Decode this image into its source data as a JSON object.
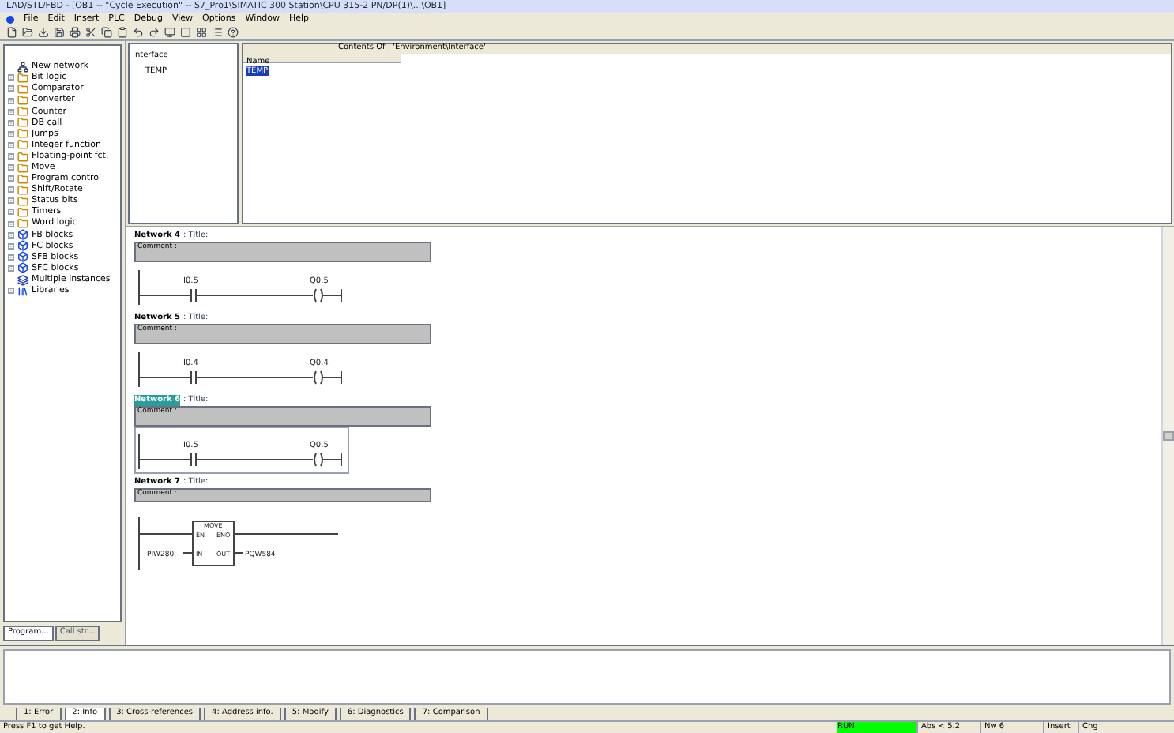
{
  "window": {
    "title": "LAD/STL/FBD - [OB1 -- \"Cycle Execution\" -- S7_Pro1\\SIMATIC 300 Station\\CPU 315-2 PN/DP(1)\\...\\OB1]"
  },
  "menu": [
    "File",
    "Edit",
    "Insert",
    "PLC",
    "Debug",
    "View",
    "Options",
    "Window",
    "Help"
  ],
  "sidebar": {
    "items": [
      {
        "label": "New network",
        "kind": "network",
        "expandable": false
      },
      {
        "label": "Bit logic",
        "kind": "folder",
        "expandable": true
      },
      {
        "label": "Comparator",
        "kind": "folder",
        "expandable": true
      },
      {
        "label": "Converter",
        "kind": "folder",
        "expandable": true
      },
      {
        "label": "Counter",
        "kind": "folder",
        "expandable": true
      },
      {
        "label": "DB call",
        "kind": "folder",
        "expandable": true
      },
      {
        "label": "Jumps",
        "kind": "folder",
        "expandable": true
      },
      {
        "label": "Integer function",
        "kind": "folder",
        "expandable": true
      },
      {
        "label": "Floating-point fct.",
        "kind": "folder",
        "expandable": true
      },
      {
        "label": "Move",
        "kind": "folder",
        "expandable": true
      },
      {
        "label": "Program control",
        "kind": "folder",
        "expandable": true
      },
      {
        "label": "Shift/Rotate",
        "kind": "folder",
        "expandable": true
      },
      {
        "label": "Status bits",
        "kind": "folder",
        "expandable": true
      },
      {
        "label": "Timers",
        "kind": "folder",
        "expandable": true
      },
      {
        "label": "Word logic",
        "kind": "folder",
        "expandable": true
      },
      {
        "label": "FB blocks",
        "kind": "block",
        "expandable": true
      },
      {
        "label": "FC blocks",
        "kind": "block",
        "expandable": true
      },
      {
        "label": "SFB blocks",
        "kind": "block",
        "expandable": true
      },
      {
        "label": "SFC blocks",
        "kind": "block",
        "expandable": true
      },
      {
        "label": "Multiple instances",
        "kind": "instances",
        "expandable": false
      },
      {
        "label": "Libraries",
        "kind": "libraries",
        "expandable": true
      }
    ],
    "tabs": [
      {
        "label": "Program...",
        "selected": true
      },
      {
        "label": "Call str...",
        "selected": false
      }
    ]
  },
  "interface": {
    "tree": [
      {
        "label": "Interface",
        "children": [
          {
            "label": "TEMP"
          }
        ]
      }
    ],
    "header": "Contents Of : 'Environment\\Interface'",
    "column": "Name",
    "rows": [
      "TEMP"
    ]
  },
  "networks": [
    {
      "number": "Network 4",
      "title": ": Title:",
      "comment": "Comment :",
      "selected": false,
      "kind": "contact",
      "input": "I0.5",
      "output": "Q0.5"
    },
    {
      "number": "Network 5",
      "title": ": Title:",
      "comment": "Comment :",
      "selected": false,
      "kind": "contact",
      "input": "I0.4",
      "output": "Q0.4"
    },
    {
      "number": "Network 6",
      "title": ": Title:",
      "comment": "Comment :",
      "selected": true,
      "kind": "contact",
      "input": "I0.5",
      "output": "Q0.5"
    },
    {
      "number": "Network 7",
      "title": ": Title:",
      "comment": "Comment :",
      "selected": false,
      "kind": "move",
      "box": "MOVE",
      "pins": [
        "EN",
        "ENO",
        "IN",
        "OUT"
      ],
      "input": "PIW280",
      "output": "PQW584"
    }
  ],
  "output_tabs": [
    {
      "label": "1: Error",
      "selected": false
    },
    {
      "label": "2: Info",
      "selected": true
    },
    {
      "label": "3: Cross-references",
      "selected": false
    },
    {
      "label": "4: Address info.",
      "selected": false
    },
    {
      "label": "5: Modify",
      "selected": false
    },
    {
      "label": "6: Diagnostics",
      "selected": false
    },
    {
      "label": "7: Comparison",
      "selected": false
    }
  ],
  "status_bar": {
    "help": "Press F1 to get Help.",
    "mode": "RUN",
    "position": "Abs < 5.2",
    "network": "Nw 6",
    "insert": "Insert",
    "change": "Chg"
  }
}
